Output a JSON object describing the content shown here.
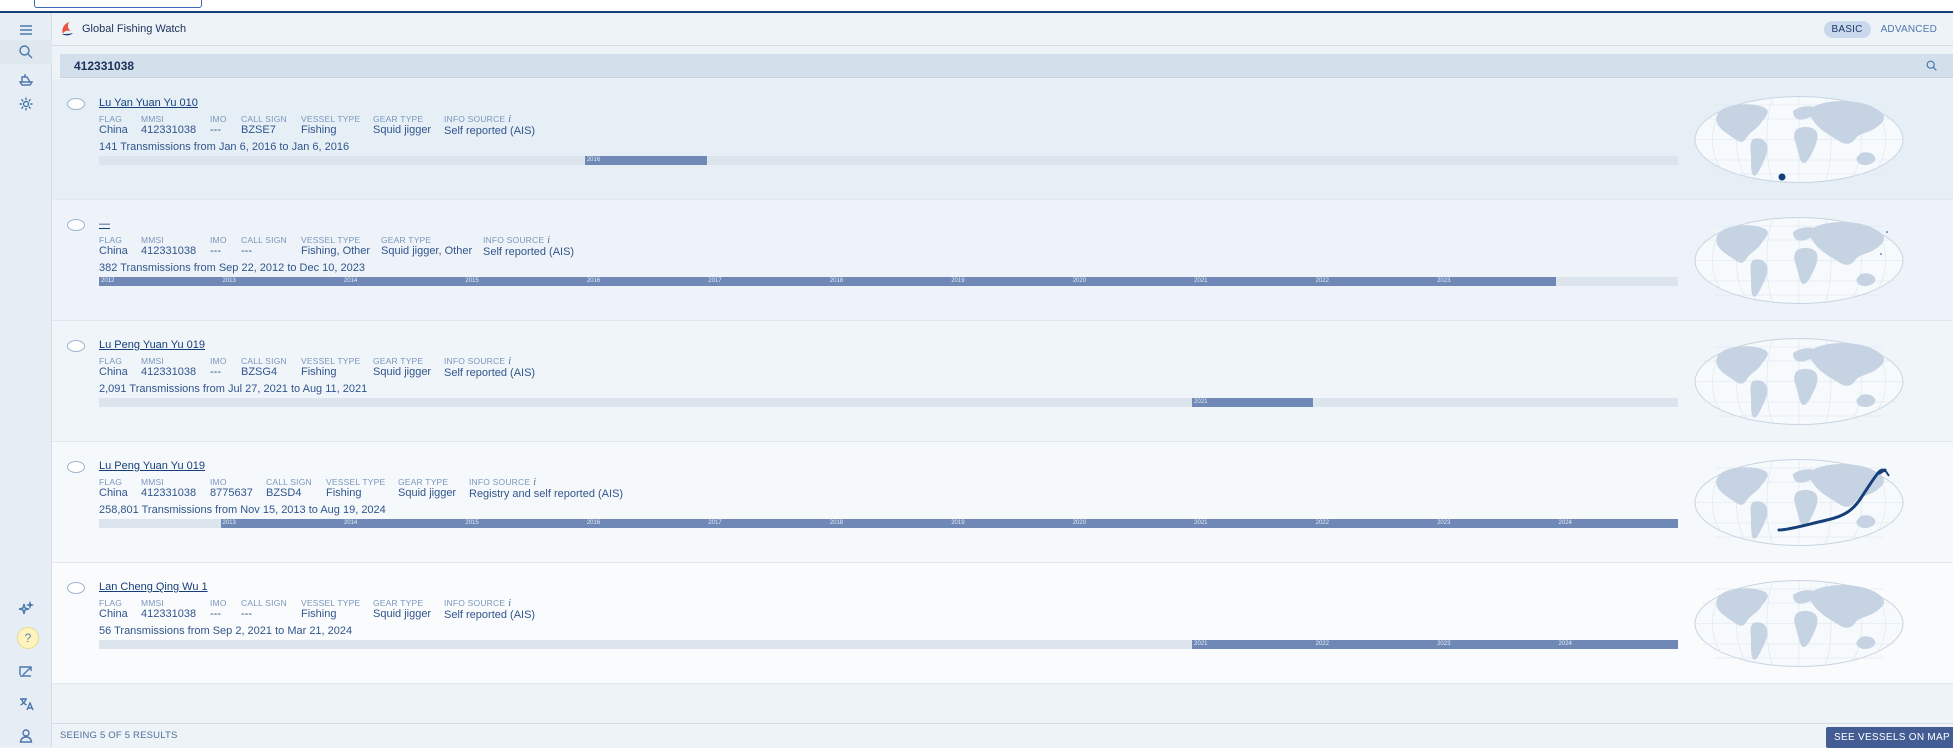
{
  "app": {
    "brand": "Global Fishing Watch"
  },
  "mode": {
    "basic": "BASIC",
    "advanced": "ADVANCED"
  },
  "search": {
    "query": "412331038"
  },
  "labels": {
    "flag": "FLAG",
    "mmsi": "MMSI",
    "imo": "IMO",
    "callsign": "CALL SIGN",
    "vessel_type": "VESSEL TYPE",
    "gear_type": "GEAR TYPE",
    "info_source": "INFO SOURCE",
    "info_marker": "i"
  },
  "results": [
    {
      "name": "Lu Yan Yuan Yu 010",
      "flag": "China",
      "mmsi": "412331038",
      "imo": "---",
      "callsign": "BZSE7",
      "vessel_type": "Fishing",
      "gear_type": "Squid jigger",
      "info_source": "Self reported (AIS)",
      "transmissions": "141 Transmissions from Jan 6, 2016 to Jan 6, 2016",
      "activity": {
        "start": 0.308,
        "end": 0.385
      },
      "years": [
        "2016"
      ]
    },
    {
      "name": "—",
      "flag": "China",
      "mmsi": "412331038",
      "imo": "---",
      "callsign": "---",
      "vessel_type": "Fishing, Other",
      "gear_type": "Squid jigger, Other",
      "info_source": "Self reported (AIS)",
      "transmissions": "382 Transmissions from Sep 22, 2012 to Dec 10, 2023",
      "activity": {
        "start": 0.0,
        "end": 0.923
      },
      "years": [
        "2012",
        "2013",
        "2014",
        "2015",
        "2016",
        "2017",
        "2018",
        "2019",
        "2020",
        "2021",
        "2022",
        "2023"
      ]
    },
    {
      "name": "Lu Peng Yuan Yu 019",
      "flag": "China",
      "mmsi": "412331038",
      "imo": "---",
      "callsign": "BZSG4",
      "vessel_type": "Fishing",
      "gear_type": "Squid jigger",
      "info_source": "Self reported (AIS)",
      "transmissions": "2,091 Transmissions from Jul 27, 2021 to Aug 11, 2021",
      "activity": {
        "start": 0.692,
        "end": 0.769
      },
      "years": [
        "2021"
      ]
    },
    {
      "name": "Lu Peng Yuan Yu 019",
      "flag": "China",
      "mmsi": "412331038",
      "imo": "8775637",
      "callsign": "BZSD4",
      "vessel_type": "Fishing",
      "gear_type": "Squid jigger",
      "info_source": "Registry and self reported (AIS)",
      "transmissions": "258,801 Transmissions from Nov 15, 2013 to Aug 19, 2024",
      "activity": {
        "start": 0.077,
        "end": 1.0
      },
      "years": [
        "2013",
        "2014",
        "2015",
        "2016",
        "2017",
        "2018",
        "2019",
        "2020",
        "2021",
        "2022",
        "2023",
        "2024"
      ]
    },
    {
      "name": "Lan Cheng Qing Wu 1",
      "flag": "China",
      "mmsi": "412331038",
      "imo": "---",
      "callsign": "---",
      "vessel_type": "Fishing",
      "gear_type": "Squid jigger",
      "info_source": "Self reported (AIS)",
      "transmissions": "56 Transmissions from Sep 2, 2021 to Mar 21, 2024",
      "activity": {
        "start": 0.692,
        "end": 1.0
      },
      "years": [
        "2021",
        "2022",
        "2023",
        "2024"
      ]
    }
  ],
  "footer": {
    "count": "SEEING 5 OF 5 RESULTS",
    "cta": "SEE VESSELS ON MAP"
  },
  "colors": {
    "accent": "#163f7a",
    "track": "#dce5ee",
    "activity": "#6f88b6",
    "cta": "#435c93",
    "help_bg": "#fff4bd"
  }
}
